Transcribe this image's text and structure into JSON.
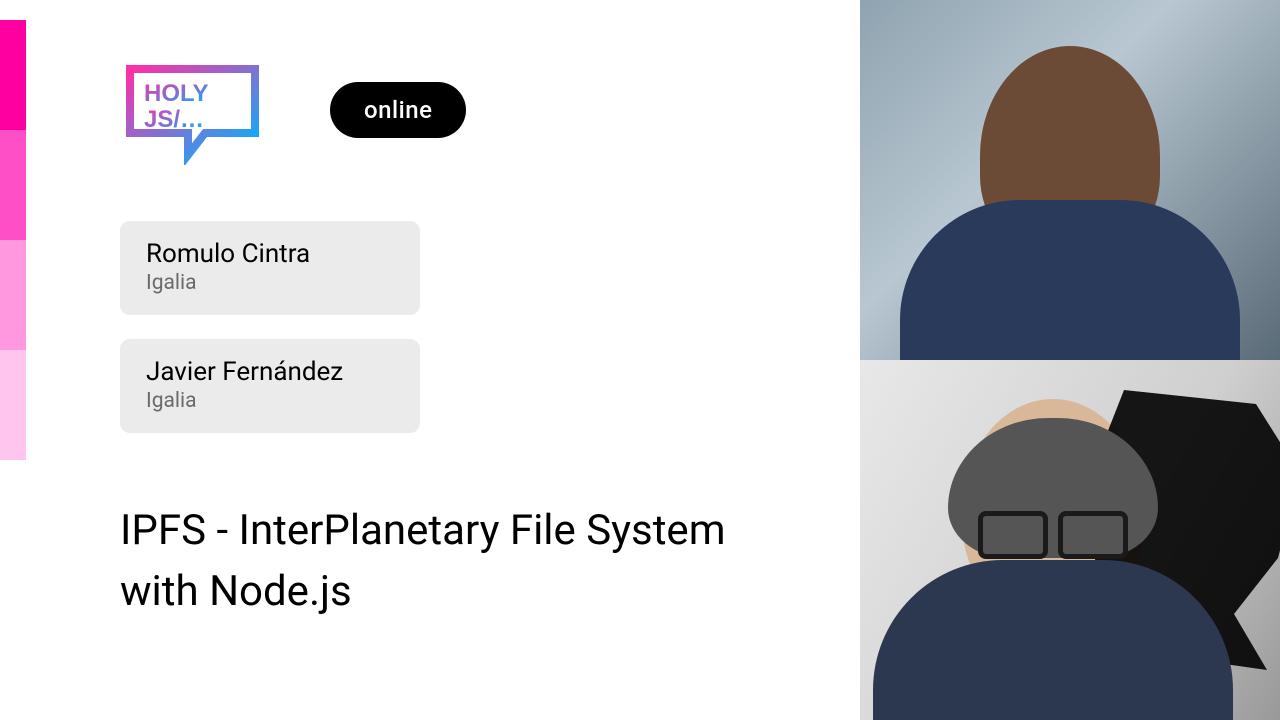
{
  "accent_colors": [
    "#ff00a0",
    "#ff4fc7",
    "#ff98df",
    "#ffc5ee"
  ],
  "logo": {
    "line1": "HOLY",
    "line2": "JS/…"
  },
  "badge": "online",
  "speakers": [
    {
      "name": "Romulo Cintra",
      "org": "Igalia"
    },
    {
      "name": "Javier Fernández",
      "org": "Igalia"
    }
  ],
  "talk_title": "IPFS - InterPlanetary File System with Node.js"
}
